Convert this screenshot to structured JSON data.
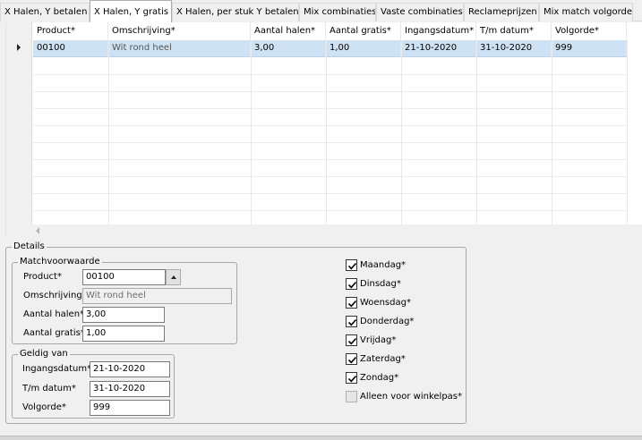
{
  "tabs": [
    {
      "label": "X Halen, Y betalen",
      "active": false
    },
    {
      "label": "X Halen, Y gratis",
      "active": true
    },
    {
      "label": "X Halen, per stuk Y betalen",
      "active": false
    },
    {
      "label": "Mix combinaties",
      "active": false
    },
    {
      "label": "Vaste combinaties",
      "active": false
    },
    {
      "label": "Reclameprijzen",
      "active": false
    },
    {
      "label": "Mix match volgorde",
      "active": false
    }
  ],
  "grid": {
    "columns": [
      "Product*",
      "Omschrijving*",
      "Aantal halen*",
      "Aantal gratis*",
      "Ingangsdatum*",
      "T/m datum*",
      "Volgorde*"
    ],
    "rows": [
      {
        "cells": [
          "00100",
          "Wit rond heel",
          "3,00",
          "1,00",
          "21-10-2020",
          "31-10-2020",
          "999"
        ],
        "selected": true
      }
    ]
  },
  "details": {
    "legend": "Details",
    "match": {
      "legend": "Matchvoorwaarde",
      "product_label": "Product*",
      "product_value": "00100",
      "omschrijving_label": "Omschrijving*",
      "omschrijving_value": "Wit rond heel",
      "aantal_halen_label": "Aantal halen*",
      "aantal_halen_value": "3,00",
      "aantal_gratis_label": "Aantal gratis*",
      "aantal_gratis_value": "1,00"
    },
    "geldig": {
      "legend": "Geldig van",
      "ingangsdatum_label": "Ingangsdatum*",
      "ingangsdatum_value": "21-10-2020",
      "tm_datum_label": "T/m datum*",
      "tm_datum_value": "31-10-2020",
      "volgorde_label": "Volgorde*",
      "volgorde_value": "999"
    },
    "days": [
      {
        "label": "Maandag*",
        "checked": true
      },
      {
        "label": "Dinsdag*",
        "checked": true
      },
      {
        "label": "Woensdag*",
        "checked": true
      },
      {
        "label": "Donderdag*",
        "checked": true
      },
      {
        "label": "Vrijdag*",
        "checked": true
      },
      {
        "label": "Zaterdag*",
        "checked": true
      },
      {
        "label": "Zondag*",
        "checked": true
      },
      {
        "label": "Alleen voor winkelpas*",
        "checked": false
      }
    ]
  }
}
